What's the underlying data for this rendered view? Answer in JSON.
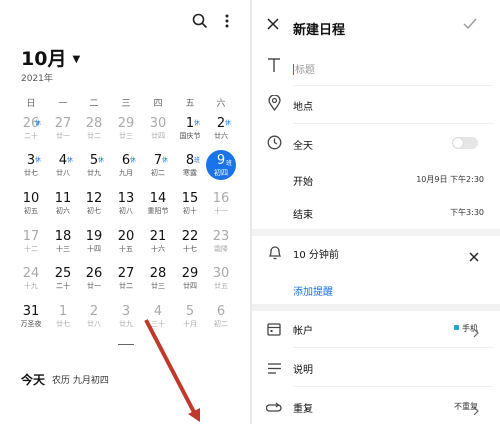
{
  "calendar": {
    "month_label": "10月",
    "year_label": "2021年",
    "weekdays": [
      "日",
      "一",
      "二",
      "三",
      "四",
      "五",
      "六"
    ],
    "days": [
      {
        "n": "26",
        "s": "二十",
        "dim": true,
        "rest": "休"
      },
      {
        "n": "27",
        "s": "廿一",
        "dim": true
      },
      {
        "n": "28",
        "s": "廿二",
        "dim": true
      },
      {
        "n": "29",
        "s": "廿三",
        "dim": true
      },
      {
        "n": "30",
        "s": "廿四",
        "dim": true
      },
      {
        "n": "1",
        "s": "国庆节",
        "rest": "休"
      },
      {
        "n": "2",
        "s": "廿六",
        "rest": "休"
      },
      {
        "n": "3",
        "s": "廿七",
        "rest": "休"
      },
      {
        "n": "4",
        "s": "廿八",
        "rest": "休"
      },
      {
        "n": "5",
        "s": "廿九",
        "rest": "休"
      },
      {
        "n": "6",
        "s": "九月",
        "rest": "休"
      },
      {
        "n": "7",
        "s": "初二",
        "rest": "休"
      },
      {
        "n": "8",
        "s": "寒露",
        "rest": "班"
      },
      {
        "n": "9",
        "s": "初四",
        "rest": "班",
        "today": true
      },
      {
        "n": "10",
        "s": "初五"
      },
      {
        "n": "11",
        "s": "初六"
      },
      {
        "n": "12",
        "s": "初七"
      },
      {
        "n": "13",
        "s": "初八"
      },
      {
        "n": "14",
        "s": "重阳节"
      },
      {
        "n": "15",
        "s": "初十"
      },
      {
        "n": "16",
        "s": "十一",
        "dim": true
      },
      {
        "n": "17",
        "s": "十二",
        "dim": true
      },
      {
        "n": "18",
        "s": "十三"
      },
      {
        "n": "19",
        "s": "十四"
      },
      {
        "n": "20",
        "s": "十五"
      },
      {
        "n": "21",
        "s": "十六"
      },
      {
        "n": "22",
        "s": "十七"
      },
      {
        "n": "23",
        "s": "霜降",
        "dim": true
      },
      {
        "n": "24",
        "s": "十九",
        "dim": true
      },
      {
        "n": "25",
        "s": "二十"
      },
      {
        "n": "26",
        "s": "廿一"
      },
      {
        "n": "27",
        "s": "廿二"
      },
      {
        "n": "28",
        "s": "廿三"
      },
      {
        "n": "29",
        "s": "廿四"
      },
      {
        "n": "30",
        "s": "廿五",
        "dim": true
      },
      {
        "n": "31",
        "s": "万圣夜"
      },
      {
        "n": "1",
        "s": "廿七",
        "dim": true
      },
      {
        "n": "2",
        "s": "廿八",
        "dim": true
      },
      {
        "n": "3",
        "s": "廿九",
        "dim": true
      },
      {
        "n": "4",
        "s": "三十",
        "dim": true
      },
      {
        "n": "5",
        "s": "十月",
        "dim": true
      },
      {
        "n": "6",
        "s": "初二",
        "dim": true
      }
    ],
    "today_label": "今天",
    "today_lunar": "农历 九月初四"
  },
  "editor": {
    "title": "新建日程",
    "title_placeholder": "标题",
    "location_label": "地点",
    "allday_label": "全天",
    "allday_on": false,
    "start_label": "开始",
    "start_value": "10月9日 下午2:30",
    "end_label": "结束",
    "end_value": "下午3:30",
    "reminder_label": "10 分钟前",
    "add_reminder_label": "添加提醒",
    "account_label": "帐户",
    "account_value": "手机",
    "description_label": "说明",
    "repeat_label": "重复",
    "repeat_value": "不重复"
  },
  "colors": {
    "accent": "#1a73e8",
    "account_dot": "#22a3d6",
    "arrow": "#c0392b"
  }
}
